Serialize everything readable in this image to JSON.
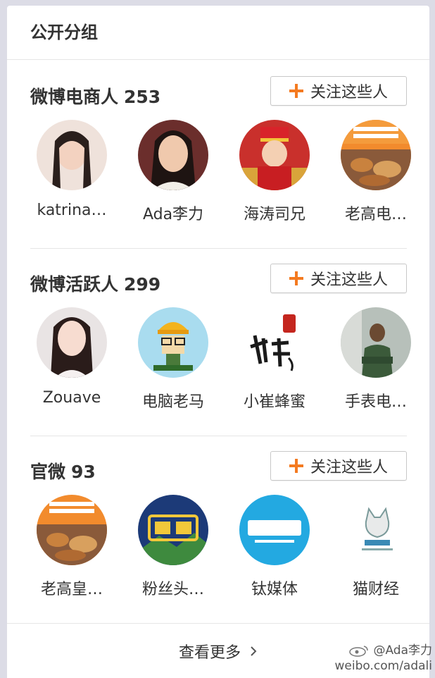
{
  "panel": {
    "title": "公开分组"
  },
  "groups": [
    {
      "name": "微博电商人",
      "count": "253",
      "follow_label": "关注这些人",
      "members": [
        {
          "name": "katrina…"
        },
        {
          "name": "Ada李力"
        },
        {
          "name": "海涛司兄"
        },
        {
          "name": "老高电…"
        }
      ]
    },
    {
      "name": "微博活跃人",
      "count": "299",
      "follow_label": "关注这些人",
      "members": [
        {
          "name": "Zouave"
        },
        {
          "name": "电脑老马"
        },
        {
          "name": "小崔蜂蜜"
        },
        {
          "name": "手表电…"
        }
      ]
    },
    {
      "name": "官微",
      "count": "93",
      "follow_label": "关注这些人",
      "members": [
        {
          "name": "老高皇…"
        },
        {
          "name": "粉丝头…"
        },
        {
          "name": "钛媒体"
        },
        {
          "name": "猫财经"
        }
      ]
    }
  ],
  "footer": {
    "more_label": "查看更多"
  },
  "watermark": {
    "handle": "@Ada李力",
    "url": "weibo.com/adali"
  },
  "colors": {
    "accent": "#f47a20",
    "text": "#333333",
    "border": "#e6e6e6",
    "background": "#dcdce6"
  }
}
